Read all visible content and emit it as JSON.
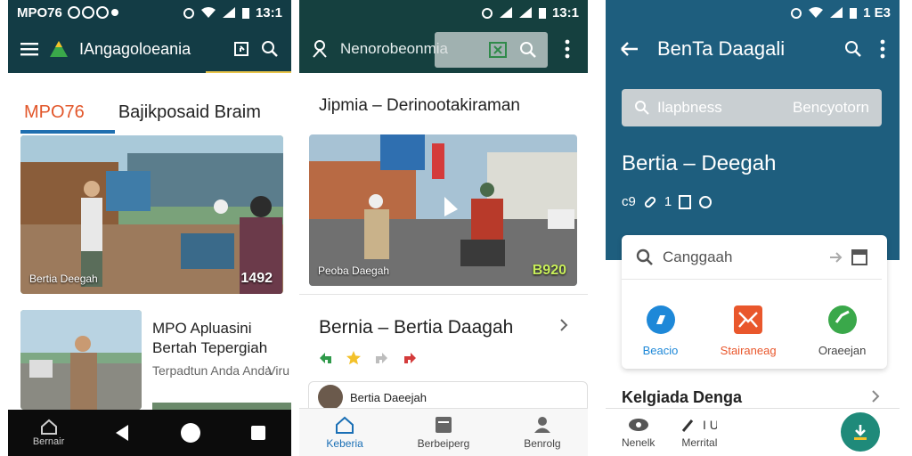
{
  "colors": {
    "p1_header": "#133c45",
    "p2_header": "#15403f",
    "p3_header": "#1e5e7e",
    "tab_active": "#e2572b",
    "tab_underline": "#1f6fb0",
    "nav_active": "#1a6fb5",
    "react_green": "#2f9a4a",
    "react_yellow": "#f3c12a",
    "react_gray": "#bdbdbd",
    "react_red": "#d43b3b",
    "action_blue": "#1e88d8",
    "action_orange": "#e9572c",
    "action_green": "#3aa84a",
    "fab": "#1f8a7a"
  },
  "phone1": {
    "status": {
      "time": "13:1",
      "left_text": "MPO76"
    },
    "appbar": {
      "title": "IAngagoloeania",
      "menu_icon": "menu-icon",
      "logo_icon": "triangle-logo-icon",
      "icons": [
        "share-icon",
        "search-icon"
      ]
    },
    "tabs": [
      {
        "label": "MPO76",
        "active": true
      },
      {
        "label": "Bajikposaid Braim",
        "active": false
      }
    ],
    "hero": {
      "caption": "Bertia Deegah",
      "number": "1492"
    },
    "article": {
      "title": "MPO Apluasini Bertah Tepergiah",
      "subtitle": "Terpadtun Anda Anda",
      "subtitle_extra": "Viru"
    },
    "navbar": {
      "home_label": "Bernair",
      "icons": [
        "home-icon",
        "back-triangle-icon",
        "home-circle-icon",
        "recents-square-icon"
      ]
    }
  },
  "phone2": {
    "status": {
      "time": "13:1"
    },
    "appbar": {
      "title": "Nenorobeonmia",
      "icons": [
        "drawing-icon",
        "excel-icon",
        "search-icon",
        "more-vert-icon"
      ]
    },
    "title": "Jipmia – Derinootakiraman",
    "hero": {
      "caption": "Peoba Daegah",
      "number": "B920"
    },
    "article": {
      "heading": "Bernia – Bertia Daagah"
    },
    "reactions": [
      "green-arrow-icon",
      "yellow-star-icon",
      "gray-arrow-icon",
      "red-arrow-icon"
    ],
    "mini_card": {
      "title": "Bertia Daeejah"
    },
    "nav": [
      {
        "label": "Keberia",
        "icon": "home-icon",
        "active": true
      },
      {
        "label": "Berbeiperg",
        "icon": "list-icon",
        "active": false
      },
      {
        "label": "Benrolg",
        "icon": "person-icon",
        "active": false
      }
    ]
  },
  "phone3": {
    "status": {
      "time": "1 E3"
    },
    "appbar": {
      "title": "BenTa Daagali",
      "back_icon": "back-arrow-icon",
      "icons": [
        "search-icon",
        "more-vert-icon"
      ]
    },
    "search": {
      "placeholder": "Ilapbness",
      "right": "Bencyotorn"
    },
    "heading": "Bertia – Deegah",
    "meta": [
      "c9",
      "1"
    ],
    "card": {
      "input_placeholder": "Canggaah",
      "actions": [
        {
          "label": "Beacio",
          "icon": "location-icon",
          "color": "#1e88d8"
        },
        {
          "label": "Stairaneag",
          "icon": "mail-icon",
          "color": "#e9572c"
        },
        {
          "label": "Oraeejan",
          "icon": "check-icon",
          "color": "#3aa84a"
        }
      ]
    },
    "section": {
      "title": "Kelgiada Denga"
    },
    "bottom": [
      {
        "label": "Nenelk",
        "icon": "eye-icon"
      },
      {
        "label": "Merrital",
        "icon": "edit-icon",
        "extra": "I U"
      }
    ],
    "fab_icon": "fab-download-icon"
  }
}
